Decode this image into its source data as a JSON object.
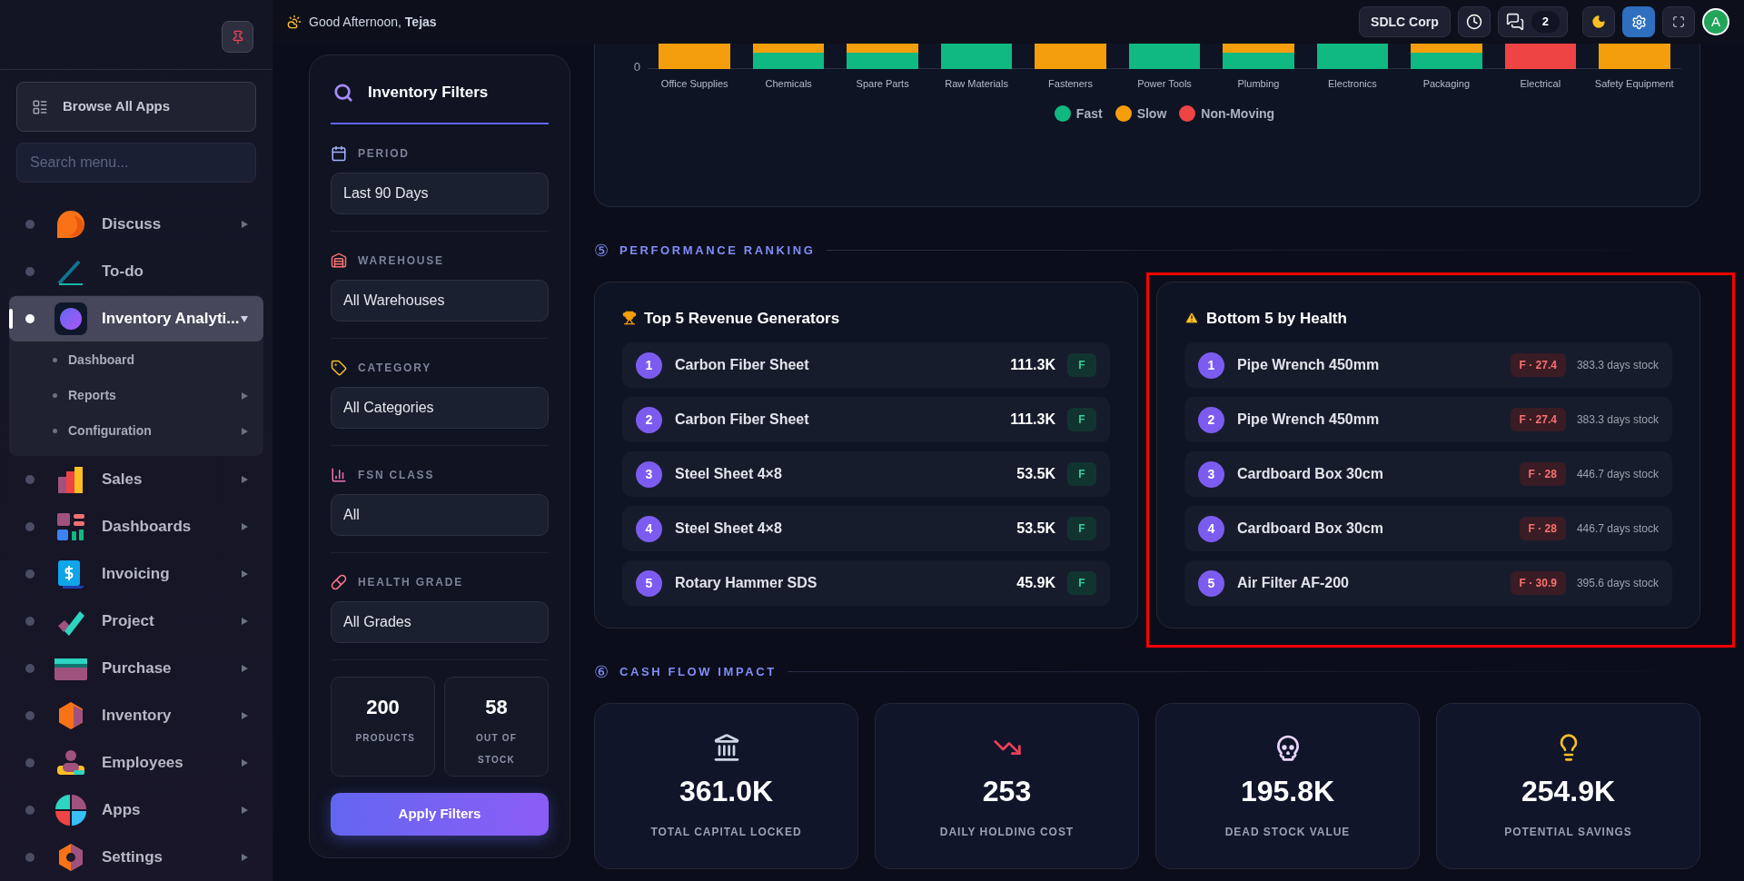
{
  "topbar": {
    "greeting": "Good Afternoon, **Tejas**",
    "company": "SDLC Corp",
    "messages_count": "2",
    "avatar": "A"
  },
  "sidebar": {
    "browse_label": "Browse All Apps",
    "search_placeholder": "Search menu...",
    "items": [
      {
        "label": "Discuss",
        "selected": false,
        "expanded": false,
        "has_submenu": true
      },
      {
        "label": "To-do",
        "selected": false,
        "has_submenu": false
      },
      {
        "label": "Inventory Analyti...",
        "selected": true,
        "expanded": true,
        "has_submenu": true,
        "children": [
          {
            "label": "Dashboard",
            "has_submenu": false
          },
          {
            "label": "Reports",
            "has_submenu": true
          },
          {
            "label": "Configuration",
            "has_submenu": true
          }
        ]
      },
      {
        "label": "Sales",
        "selected": false,
        "expanded": false,
        "has_submenu": true
      },
      {
        "label": "Dashboards",
        "selected": false,
        "expanded": false,
        "has_submenu": true
      },
      {
        "label": "Invoicing",
        "selected": false,
        "expanded": false,
        "has_submenu": true
      },
      {
        "label": "Project",
        "selected": false,
        "expanded": false,
        "has_submenu": true
      },
      {
        "label": "Purchase",
        "selected": false,
        "expanded": false,
        "has_submenu": true
      },
      {
        "label": "Inventory",
        "selected": false,
        "expanded": false,
        "has_submenu": true
      },
      {
        "label": "Employees",
        "selected": false,
        "expanded": false,
        "has_submenu": true
      },
      {
        "label": "Apps",
        "selected": false,
        "expanded": false,
        "has_submenu": true
      },
      {
        "label": "Settings",
        "selected": false,
        "expanded": false,
        "has_submenu": true
      }
    ]
  },
  "filters": {
    "title": "Inventory Filters",
    "groups": [
      {
        "label": "PERIOD",
        "value": "Last 90 Days"
      },
      {
        "label": "WAREHOUSE",
        "value": "All Warehouses"
      },
      {
        "label": "CATEGORY",
        "value": "All Categories"
      },
      {
        "label": "FSN CLASS",
        "value": "All"
      },
      {
        "label": "HEALTH GRADE",
        "value": "All Grades"
      }
    ],
    "stats": [
      {
        "value": "200",
        "label": "PRODUCTS"
      },
      {
        "value": "58",
        "label": "OUT OF STOCK"
      }
    ],
    "apply_label": "Apply Filters"
  },
  "fsn_chart": {
    "y_tick": "0",
    "categories": [
      {
        "label": "Office Supplies",
        "kind": "slow"
      },
      {
        "label": "Chemicals",
        "kind": "mixed"
      },
      {
        "label": "Spare Parts",
        "kind": "mixed"
      },
      {
        "label": "Raw Materials",
        "kind": "fast"
      },
      {
        "label": "Fasteners",
        "kind": "slow"
      },
      {
        "label": "Power Tools",
        "kind": "fast"
      },
      {
        "label": "Plumbing",
        "kind": "mixed"
      },
      {
        "label": "Electronics",
        "kind": "fast"
      },
      {
        "label": "Packaging",
        "kind": "mixed"
      },
      {
        "label": "Electrical",
        "kind": "non-moving"
      },
      {
        "label": "Safety Equipment",
        "kind": "slow"
      }
    ],
    "legend": [
      {
        "label": "Fast",
        "color": "#10b981"
      },
      {
        "label": "Slow",
        "color": "#f59e0b"
      },
      {
        "label": "Non-Moving",
        "color": "#ef4444"
      }
    ]
  },
  "ranking": {
    "number": "⑤",
    "title": "PERFORMANCE RANKING",
    "top": {
      "title": "Top 5 Revenue Generators",
      "rows": [
        {
          "rank": "1",
          "name": "Carbon Fiber Sheet",
          "value": "111.3K",
          "grade": "F"
        },
        {
          "rank": "2",
          "name": "Carbon Fiber Sheet",
          "value": "111.3K",
          "grade": "F"
        },
        {
          "rank": "3",
          "name": "Steel Sheet 4×8",
          "value": "53.5K",
          "grade": "F"
        },
        {
          "rank": "4",
          "name": "Steel Sheet 4×8",
          "value": "53.5K",
          "grade": "F"
        },
        {
          "rank": "5",
          "name": "Rotary Hammer SDS",
          "value": "45.9K",
          "grade": "F"
        }
      ]
    },
    "bottom": {
      "title": "Bottom 5 by Health",
      "highlighted": true,
      "rows": [
        {
          "rank": "1",
          "name": "Pipe Wrench 450mm",
          "score": "F · 27.4",
          "days": "383.3 days stock"
        },
        {
          "rank": "2",
          "name": "Pipe Wrench 450mm",
          "score": "F · 27.4",
          "days": "383.3 days stock"
        },
        {
          "rank": "3",
          "name": "Cardboard Box 30cm",
          "score": "F · 28",
          "days": "446.7 days stock"
        },
        {
          "rank": "4",
          "name": "Cardboard Box 30cm",
          "score": "F · 28",
          "days": "446.7 days stock"
        },
        {
          "rank": "5",
          "name": "Air Filter AF-200",
          "score": "F · 30.9",
          "days": "395.6 days stock"
        }
      ]
    }
  },
  "cash_flow": {
    "number": "⑥",
    "title": "CASH FLOW IMPACT",
    "metrics": [
      {
        "value": "361.0K",
        "label": "TOTAL CAPITAL LOCKED"
      },
      {
        "value": "253",
        "label": "DAILY HOLDING COST"
      },
      {
        "value": "195.8K",
        "label": "DEAD STOCK VALUE"
      },
      {
        "value": "254.9K",
        "label": "POTENTIAL SAVINGS"
      }
    ]
  }
}
